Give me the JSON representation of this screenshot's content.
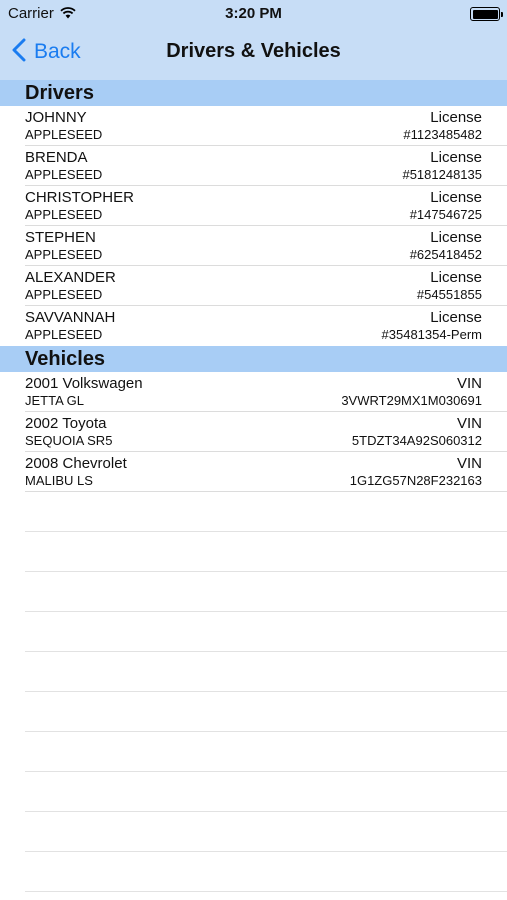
{
  "status_bar": {
    "carrier": "Carrier",
    "time": "3:20 PM",
    "battery_level": 1.0
  },
  "nav": {
    "back_label": "Back",
    "title": "Drivers & Vehicles",
    "tint_color": "#1a7cf0",
    "bar_color": "#c7ddf6"
  },
  "drivers": {
    "header": "Drivers",
    "items": [
      {
        "first": "JOHNNY",
        "last": "APPLESEED",
        "label": "License",
        "number": "#1123485482"
      },
      {
        "first": "BRENDA",
        "last": "APPLESEED",
        "label": "License",
        "number": "#5181248135"
      },
      {
        "first": "CHRISTOPHER",
        "last": "APPLESEED",
        "label": "License",
        "number": "#147546725"
      },
      {
        "first": "STEPHEN",
        "last": "APPLESEED",
        "label": "License",
        "number": "#625418452"
      },
      {
        "first": "ALEXANDER",
        "last": "APPLESEED",
        "label": "License",
        "number": "#54551855"
      },
      {
        "first": "SAVVANNAH",
        "last": "APPLESEED",
        "label": "License",
        "number": "#35481354-Perm"
      }
    ]
  },
  "vehicles": {
    "header": "Vehicles",
    "items": [
      {
        "make": "2001 Volkswagen",
        "model": "JETTA GL",
        "label": "VIN",
        "vin": "3VWRT29MX1M030691"
      },
      {
        "make": "2002 Toyota",
        "model": "SEQUOIA SR5",
        "label": "VIN",
        "vin": "5TDZT34A92S060312"
      },
      {
        "make": "2008 Chevrolet",
        "model": "MALIBU LS",
        "label": "VIN",
        "vin": "1G1ZG57N28F232163"
      }
    ]
  },
  "section_color": "#a8cdf5"
}
